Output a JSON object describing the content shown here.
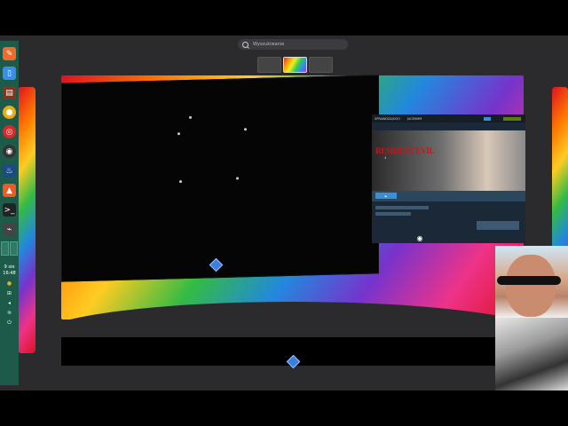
{
  "search": {
    "placeholder": "Wyszukiwanie"
  },
  "dock": {
    "apps": [
      {
        "icon": "notes-icon",
        "color": "#f06a2a"
      },
      {
        "icon": "phone-icon",
        "color": "#3a8ee6"
      },
      {
        "icon": "calculator-icon",
        "color": "#7a3a22"
      },
      {
        "icon": "chrome-icon",
        "color": "#e8ae1a"
      },
      {
        "icon": "lifebuoy-icon",
        "color": "#d52b2b"
      },
      {
        "icon": "obs-icon",
        "color": "#333333"
      },
      {
        "icon": "steam-icon",
        "color": "#1b4a86"
      },
      {
        "icon": "flame-icon",
        "color": "#ee5a22"
      },
      {
        "icon": "terminal-icon",
        "color": "#222222"
      },
      {
        "icon": "system-monitor-icon",
        "color": "#444444"
      }
    ],
    "date": "9 sie",
    "time": "16:48"
  },
  "steam_window": {
    "nav_left": "SPRAWDZAJOGO",
    "nav_right": "JACEKMM",
    "game_title": "RESIDENT EVIL",
    "game_subtitle": "4"
  }
}
